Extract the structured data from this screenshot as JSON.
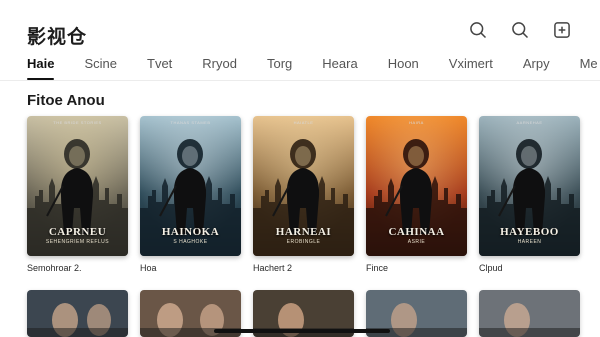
{
  "app": {
    "title": "影视仓"
  },
  "actions": {
    "search_icon": "search-icon",
    "search2_icon": "search-icon",
    "add_icon": "add-icon"
  },
  "tabs": [
    {
      "label": "Haie",
      "active": true
    },
    {
      "label": "Scine"
    },
    {
      "label": "Tvet"
    },
    {
      "label": "Rryod"
    },
    {
      "label": "Torg"
    },
    {
      "label": "Heara"
    },
    {
      "label": "Hoon"
    },
    {
      "label": "Vximert"
    },
    {
      "label": "Arpy"
    },
    {
      "label": "Me"
    }
  ],
  "section": {
    "title": "Fitoe Anou"
  },
  "cards": [
    {
      "credit": "THE BRIDE STORIES",
      "poster_title": "CAPRNEU",
      "poster_sub": "SEHENGRIEM REFLUS",
      "label": "Semohroar 2.",
      "palette": {
        "sky": "#c9c0a4",
        "mid": "#6b6657",
        "ground": "#2b2a25",
        "accent": "#e6d6a8"
      }
    },
    {
      "credit": "THANAS STAMEB",
      "poster_title": "HAINOKA",
      "poster_sub": "S HAGHOKE",
      "label": "Hoa",
      "palette": {
        "sky": "#a7c3cf",
        "mid": "#2f4c5a",
        "ground": "#13212a",
        "accent": "#d9e6ec"
      }
    },
    {
      "credit": "HAIATLE",
      "poster_title": "HARNEAI",
      "poster_sub": "EROBINGLE",
      "label": "Hachert 2",
      "palette": {
        "sky": "#e7c38f",
        "mid": "#7a5a33",
        "ground": "#2d2013",
        "accent": "#f5d9a6"
      }
    },
    {
      "credit": "HAIRA",
      "poster_title": "CAHINAA",
      "poster_sub": "ASRIE",
      "label": "Fince",
      "palette": {
        "sky": "#f08a2c",
        "mid": "#a5391b",
        "ground": "#2a120b",
        "accent": "#ffd08a"
      }
    },
    {
      "credit": "AARNEHAE",
      "poster_title": "HAYEBOO",
      "poster_sub": "HAREEN",
      "label": "Clpud",
      "palette": {
        "sky": "#9eb4bd",
        "mid": "#3a4d55",
        "ground": "#141d22",
        "accent": "#dde6e9"
      }
    }
  ],
  "row2": [
    {
      "palette": {
        "bg": "#3c4650",
        "face": "#b79a83"
      }
    },
    {
      "palette": {
        "bg": "#6a5647",
        "face": "#c8a489"
      }
    },
    {
      "palette": {
        "bg": "#4a4034",
        "face": "#c29a7c"
      }
    },
    {
      "palette": {
        "bg": "#5f6c76",
        "face": "#b89c88"
      }
    },
    {
      "palette": {
        "bg": "#6d7278",
        "face": "#c0a490"
      }
    }
  ]
}
